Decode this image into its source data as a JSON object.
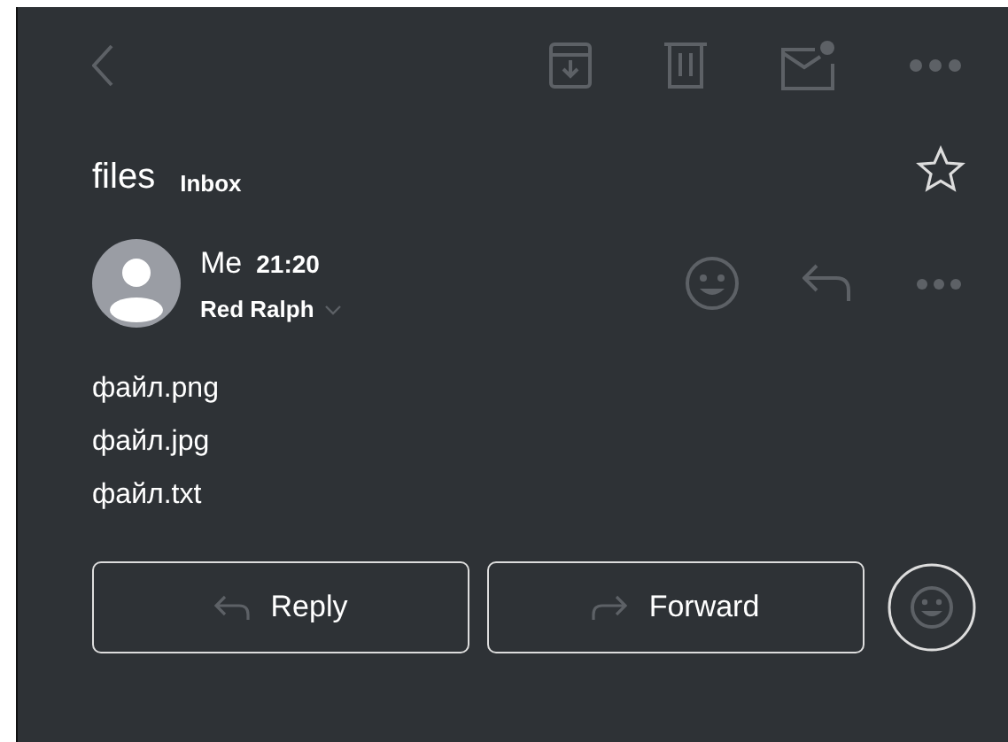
{
  "message": {
    "subject": "files",
    "folder": "Inbox",
    "sender": "Me",
    "time": "21:20",
    "recipient": "Red Ralph",
    "body": [
      "файл.png",
      "файл.jpg",
      "файл.txt"
    ]
  },
  "buttons": [
    {
      "kind": "reply",
      "label": "Reply"
    },
    {
      "kind": "forward",
      "label": "Forward"
    }
  ]
}
